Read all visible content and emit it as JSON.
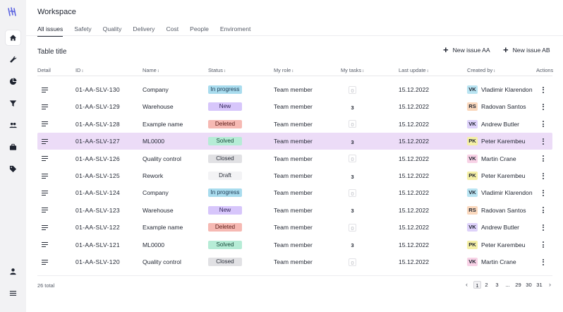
{
  "app": {
    "title": "Workspace"
  },
  "tabs": [
    {
      "label": "All issues",
      "active": true
    },
    {
      "label": "Safety"
    },
    {
      "label": "Quality"
    },
    {
      "label": "Delivery"
    },
    {
      "label": "Cost"
    },
    {
      "label": "People"
    },
    {
      "label": "Enviroment"
    }
  ],
  "table": {
    "title": "Table title",
    "new_issue_a": "New issue AA",
    "new_issue_b": "New issue AB",
    "columns": [
      "Detail",
      "ID",
      "Name",
      "Status",
      "My role",
      "My tasks",
      "Last update",
      "Created by",
      "Actions"
    ],
    "rows": [
      {
        "id": "01-AA-SLV-130",
        "name": "Company",
        "status": "In progress",
        "role": "Team member",
        "tasks": "0",
        "updated": "15.12.2022",
        "initials": "VK",
        "creator": "Vladimir Klarendon"
      },
      {
        "id": "01-AA-SLV-129",
        "name": "Warehouse",
        "status": "New",
        "role": "Team member",
        "tasks": "3",
        "updated": "15.12.2022",
        "initials": "RS",
        "creator": "Radovan Santos"
      },
      {
        "id": "01-AA-SLV-128",
        "name": "Example name",
        "status": "Deleted",
        "role": "Team member",
        "tasks": "0",
        "updated": "15.12.2022",
        "initials": "VK",
        "creator": "Andrew Butler"
      },
      {
        "id": "01-AA-SLV-127",
        "name": "ML0000",
        "status": "Solved",
        "role": "Team member",
        "tasks": "3",
        "updated": "15.12.2022",
        "initials": "PK",
        "creator": "Peter Karembeu",
        "selected": true
      },
      {
        "id": "01-AA-SLV-126",
        "name": "Quality control",
        "status": "Closed",
        "role": "Team member",
        "tasks": "0",
        "updated": "15.12.2022",
        "initials": "VK",
        "creator": "Martin Crane"
      },
      {
        "id": "01-AA-SLV-125",
        "name": "Rework",
        "status": "Draft",
        "role": "Team member",
        "tasks": "3",
        "updated": "15.12.2022",
        "initials": "PK",
        "creator": "Peter Karembeu"
      },
      {
        "id": "01-AA-SLV-124",
        "name": "Company",
        "status": "In progress",
        "role": "Team member",
        "tasks": "0",
        "updated": "15.12.2022",
        "initials": "VK",
        "creator": "Vladimir Klarendon"
      },
      {
        "id": "01-AA-SLV-123",
        "name": "Warehouse",
        "status": "New",
        "role": "Team member",
        "tasks": "3",
        "updated": "15.12.2022",
        "initials": "RS",
        "creator": "Radovan Santos"
      },
      {
        "id": "01-AA-SLV-122",
        "name": "Example name",
        "status": "Deleted",
        "role": "Team member",
        "tasks": "0",
        "updated": "15.12.2022",
        "initials": "VK",
        "creator": "Andrew Butler"
      },
      {
        "id": "01-AA-SLV-121",
        "name": "ML0000",
        "status": "Solved",
        "role": "Team member",
        "tasks": "3",
        "updated": "15.12.2022",
        "initials": "PK",
        "creator": "Peter Karembeu"
      },
      {
        "id": "01-AA-SLV-120",
        "name": "Quality control",
        "status": "Closed",
        "role": "Team member",
        "tasks": "0",
        "updated": "15.12.2022",
        "initials": "VK",
        "creator": "Martin Crane"
      }
    ],
    "total": "26 total"
  },
  "pagination": {
    "pages": [
      "1",
      "2",
      "3",
      "...",
      "29",
      "30",
      "31"
    ],
    "current": "1"
  },
  "status_colors": {
    "In progress": {
      "bg": "#a9dcee",
      "fg": "#1f3b54"
    },
    "New": {
      "bg": "#d7c6fb",
      "fg": "#2b1f54"
    },
    "Deleted": {
      "bg": "#f6b9b3",
      "fg": "#5a1a16"
    },
    "Solved": {
      "bg": "#b6ecd6",
      "fg": "#184a3a"
    },
    "Closed": {
      "bg": "#e1e1e4",
      "fg": "#2a2f3a"
    },
    "Draft": {
      "bg": "#f3f3f5",
      "fg": "#2a2f3a"
    }
  },
  "avatar_colors": {
    "VK_teal": "#b9e4f2",
    "VK_purple": "#ded2fa",
    "VK_pink": "#f8d2e6",
    "RS": "#fad8bd",
    "PK": "#f5f0a6"
  },
  "sidebar_icons": [
    "home-icon",
    "wrench-icon",
    "pie-chart-icon",
    "filter-icon",
    "people-icon",
    "briefcase-icon",
    "tag-icon",
    "user-icon",
    "menu-icon"
  ],
  "selected_row_color": "#ecdcf7"
}
